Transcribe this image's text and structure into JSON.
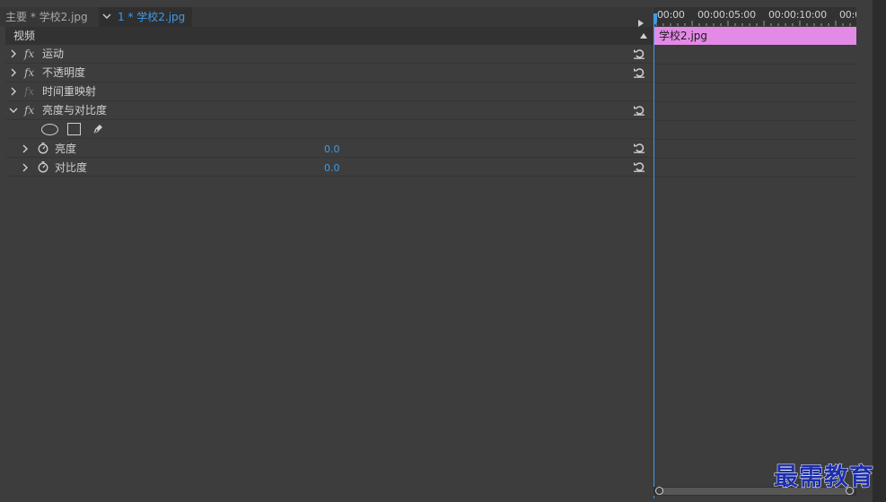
{
  "tabs": {
    "source_tab": "主要 * 学校2.jpg",
    "active_tab": "1 * 学校2.jpg"
  },
  "section": {
    "title": "视频"
  },
  "effects": [
    {
      "name": "运动",
      "fx": "fx",
      "enabled": true,
      "expanded": false,
      "has_reset": true
    },
    {
      "name": "不透明度",
      "fx": "fx",
      "enabled": true,
      "expanded": false,
      "has_reset": true
    },
    {
      "name": "时间重映射",
      "fx": "fx",
      "enabled": false,
      "expanded": false,
      "has_reset": false
    },
    {
      "name": "亮度与对比度",
      "fx": "fx",
      "enabled": true,
      "expanded": true,
      "has_reset": true
    }
  ],
  "mask_tools": [
    "ellipse-mask-icon",
    "rectangle-mask-icon",
    "pen-mask-icon"
  ],
  "params": [
    {
      "name": "亮度",
      "value": "0.0"
    },
    {
      "name": "对比度",
      "value": "0.0"
    }
  ],
  "timeline": {
    "timecodes": [
      "00:00",
      "00:00:05:00",
      "00:00:10:00",
      "00:0"
    ],
    "clip_name": "学校2.jpg"
  },
  "colors": {
    "accent_blue": "#3d9bea",
    "clip_pink": "#e38ae6",
    "panel_bg": "#3d3d3d"
  },
  "watermark": "最需教育"
}
